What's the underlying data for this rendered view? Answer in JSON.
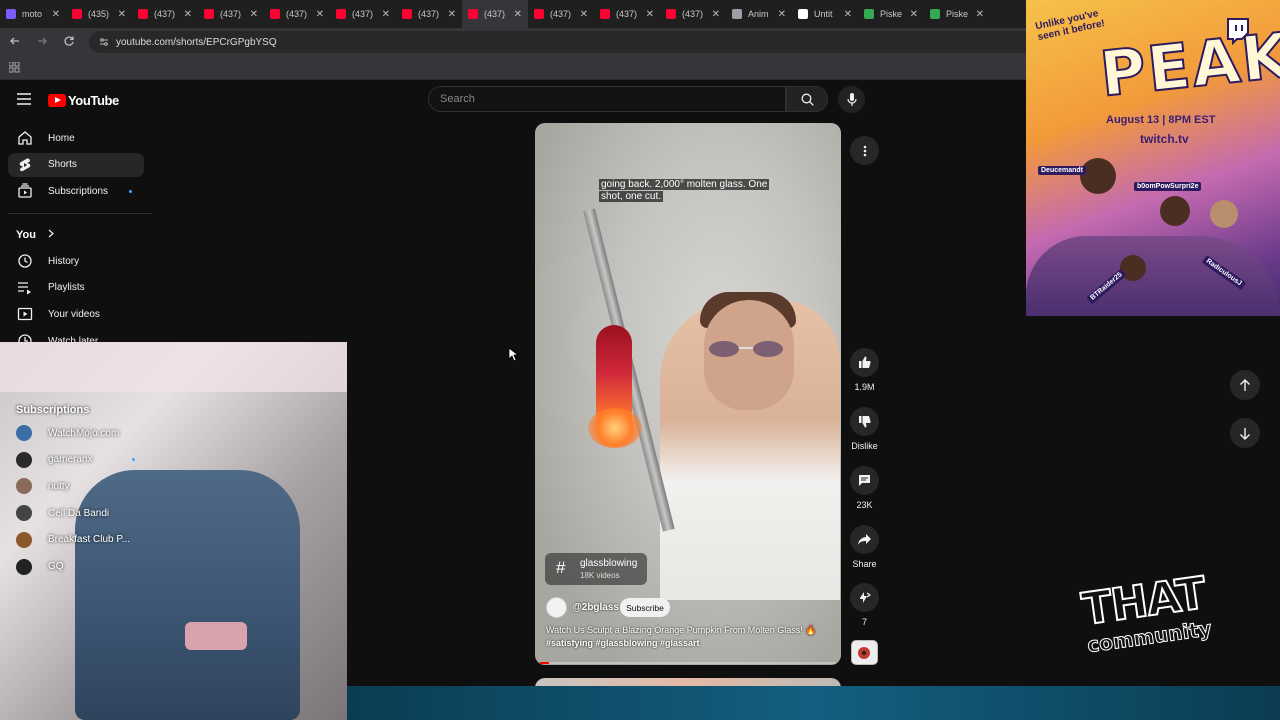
{
  "browser": {
    "tabs": [
      {
        "label": "moto",
        "color": "#7b5cff"
      },
      {
        "label": "(435)",
        "color": "#ff0033"
      },
      {
        "label": "(437)",
        "color": "#ff0033"
      },
      {
        "label": "(437)",
        "color": "#ff0033"
      },
      {
        "label": "(437)",
        "color": "#ff0033"
      },
      {
        "label": "(437)",
        "color": "#ff0033"
      },
      {
        "label": "(437)",
        "color": "#ff0033"
      },
      {
        "label": "(437)",
        "color": "#ff0033",
        "active": true
      },
      {
        "label": "(437)",
        "color": "#ff0033"
      },
      {
        "label": "(437)",
        "color": "#ff0033"
      },
      {
        "label": "(437)",
        "color": "#ff0033"
      },
      {
        "label": "Anim",
        "color": "#9aa0a6"
      },
      {
        "label": "Untit",
        "color": "#ffffff"
      },
      {
        "label": "Piske",
        "color": "#34a853"
      },
      {
        "label": "Piske",
        "color": "#34a853"
      }
    ],
    "url": "youtube.com/shorts/EPCrGPgbYSQ"
  },
  "youtube": {
    "logo_text": "YouTube",
    "search_placeholder": "Search",
    "sidebar": {
      "items": [
        {
          "label": "Home",
          "icon": "home-icon"
        },
        {
          "label": "Shorts",
          "icon": "shorts-icon",
          "active": true
        },
        {
          "label": "Subscriptions",
          "icon": "subscriptions-icon",
          "dot": true
        }
      ],
      "you_label": "You",
      "you_items": [
        {
          "label": "History",
          "icon": "history-icon"
        },
        {
          "label": "Playlists",
          "icon": "playlists-icon"
        },
        {
          "label": "Your videos",
          "icon": "your-videos-icon"
        },
        {
          "label": "Watch later",
          "icon": "watch-later-icon"
        }
      ],
      "subscriptions_label": "Subscriptions",
      "subscriptions": [
        {
          "name": "WatchMojo.com",
          "color": "#3a6ea5"
        },
        {
          "name": "gameranx",
          "color": "#2b2b2b",
          "dot": true
        },
        {
          "name": "nutty",
          "color": "#8a6a5a"
        },
        {
          "name": "Cell Da Bandi",
          "color": "#444"
        },
        {
          "name": "Breakfast Club P...",
          "color": "#8b5a2b"
        },
        {
          "name": "GQ",
          "color": "#222"
        }
      ]
    },
    "short": {
      "caption": "going back. 2,000° molten glass. One shot, one cut.",
      "hashtag": "glassblowing",
      "hashtag_count": "18K videos",
      "channel": "@2bglass",
      "subscribe_label": "Subscribe",
      "title": "Watch Us Sculpt a Blazing Orange Pumpkin From Molten Glass! 🔥",
      "tags": "#satisfying #glassblowing #glassart",
      "progress": 0.03
    },
    "actions": {
      "likes": "1.9M",
      "dislike": "Dislike",
      "comments": "23K",
      "share": "Share",
      "remix": "7"
    }
  },
  "promo": {
    "tagline": "Unlike you've seen it before!",
    "title": "PEAK",
    "date": "August 13 | 8PM EST",
    "site": "twitch.tv",
    "names": [
      "Deucemandt",
      "b0omPowSurpri2e",
      "RadiculousJ",
      "BTRaider25"
    ]
  },
  "community_logo": {
    "line1": "THAT",
    "line2": "community"
  }
}
